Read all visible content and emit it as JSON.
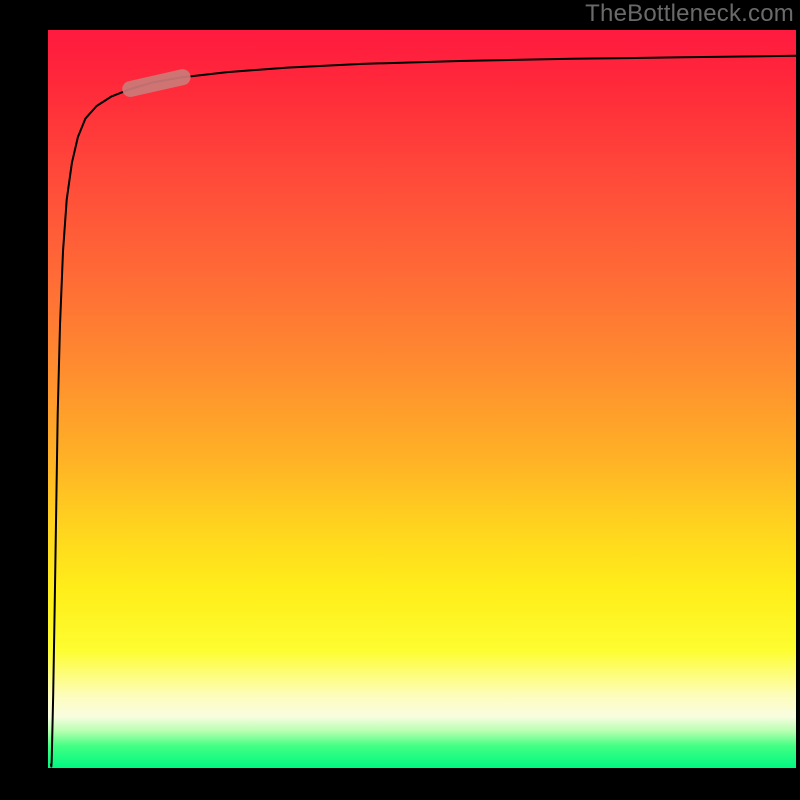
{
  "watermark": "TheBottleneck.com",
  "chart_data": {
    "type": "line",
    "title": "",
    "xlabel": "",
    "ylabel": "",
    "xlim": [
      0,
      100
    ],
    "ylim": [
      0,
      100
    ],
    "background": {
      "style": "vertical-gradient",
      "stops": [
        {
          "pos": 0.0,
          "color": "#ff1a3f"
        },
        {
          "pos": 0.45,
          "color": "#ff8a30"
        },
        {
          "pos": 0.76,
          "color": "#ffee1a"
        },
        {
          "pos": 0.93,
          "color": "#f9fde0"
        },
        {
          "pos": 1.0,
          "color": "#00f880"
        }
      ]
    },
    "series": [
      {
        "name": "bottleneck-curve",
        "x": [
          0.5,
          0.7,
          0.9,
          1.1,
          1.3,
          1.6,
          2.0,
          2.5,
          3.2,
          4.0,
          5.0,
          6.5,
          8.5,
          11,
          14,
          18,
          24,
          32,
          42,
          55,
          70,
          85,
          100
        ],
        "y": [
          1,
          10,
          22,
          35,
          48,
          60,
          70,
          77,
          82,
          85.5,
          88,
          89.7,
          91,
          92,
          92.9,
          93.6,
          94.3,
          94.9,
          95.4,
          95.8,
          96.1,
          96.3,
          96.5
        ]
      }
    ],
    "highlight_segment": {
      "series": "bottleneck-curve",
      "x_start": 11,
      "x_end": 18,
      "note": "thick rounded red-ish overlay on the curve near the knee"
    }
  }
}
